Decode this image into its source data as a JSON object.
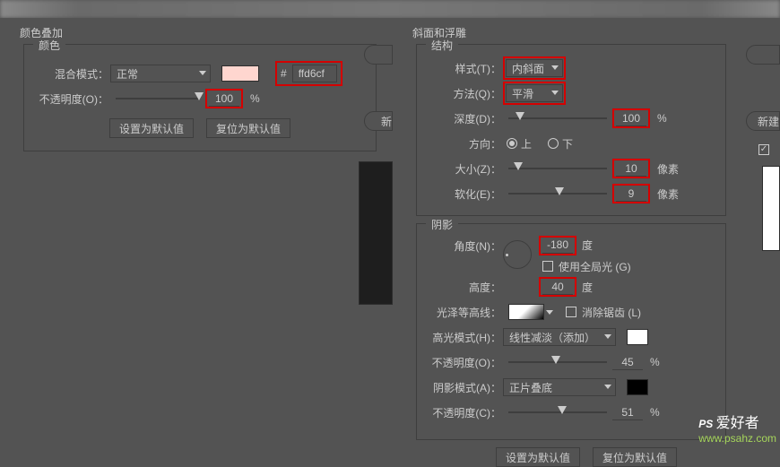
{
  "topbar": {},
  "color_overlay": {
    "panel_title": "颜色叠加",
    "fieldset_title": "颜色",
    "blend_mode_label": "混合模式：",
    "blend_mode_value": "正常",
    "swatch_color": "#ffd6cf",
    "hex_prefix": "#",
    "hex_value": "ffd6cf",
    "opacity_label": "不透明度(O)：",
    "opacity_value": "100",
    "opacity_unit": "%",
    "set_default": "设置为默认值",
    "reset_default": "复位为默认值"
  },
  "bevel": {
    "panel_title": "斜面和浮雕",
    "structure_title": "结构",
    "style_label": "样式(T)：",
    "style_value": "内斜面",
    "technique_label": "方法(Q)：",
    "technique_value": "平滑",
    "depth_label": "深度(D)：",
    "depth_value": "100",
    "depth_unit": "%",
    "direction_label": "方向：",
    "direction_up": "上",
    "direction_down": "下",
    "direction_selected": "up",
    "size_label": "大小(Z)：",
    "size_value": "10",
    "size_unit": "像素",
    "soften_label": "软化(E)：",
    "soften_value": "9",
    "soften_unit": "像素",
    "shading_title": "阴影",
    "angle_label": "角度(N)：",
    "angle_value": "-180",
    "angle_unit": "度",
    "global_light_label": "使用全局光 (G)",
    "global_light_checked": false,
    "altitude_label": "高度：",
    "altitude_value": "40",
    "altitude_unit": "度",
    "gloss_label": "光泽等高线：",
    "antialias_label": "消除锯齿 (L)",
    "antialias_checked": false,
    "highlight_mode_label": "高光模式(H)：",
    "highlight_mode_value": "线性减淡（添加）",
    "highlight_swatch": "#ffffff",
    "highlight_opacity_label": "不透明度(O)：",
    "highlight_opacity_value": "45",
    "highlight_opacity_unit": "%",
    "shadow_mode_label": "阴影模式(A)：",
    "shadow_mode_value": "正片叠底",
    "shadow_swatch": "#000000",
    "shadow_opacity_label": "不透明度(C)：",
    "shadow_opacity_value": "51",
    "shadow_opacity_unit": "%",
    "set_default": "设置为默认值",
    "reset_default": "复位为默认值"
  },
  "side_buttons": {
    "new_left": "新",
    "new_right": "新建"
  },
  "watermark": {
    "ps": "PS",
    "cn": "爱好者",
    "url": "www.psahz.com"
  }
}
